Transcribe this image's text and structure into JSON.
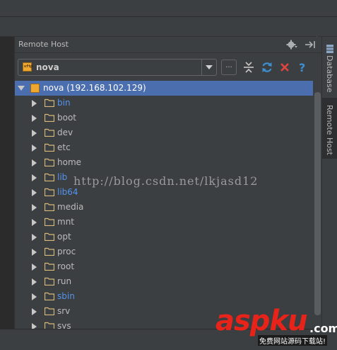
{
  "panel": {
    "title": "Remote Host",
    "host": {
      "name": "nova",
      "browse_label": "..."
    }
  },
  "tree": {
    "root": {
      "label": "nova (192.168.102.129)",
      "expanded": true,
      "selected": true
    },
    "items": [
      {
        "label": "bin",
        "link": true
      },
      {
        "label": "boot",
        "link": false
      },
      {
        "label": "dev",
        "link": false
      },
      {
        "label": "etc",
        "link": false
      },
      {
        "label": "home",
        "link": false
      },
      {
        "label": "lib",
        "link": true
      },
      {
        "label": "lib64",
        "link": true
      },
      {
        "label": "media",
        "link": false
      },
      {
        "label": "mnt",
        "link": false
      },
      {
        "label": "opt",
        "link": false
      },
      {
        "label": "proc",
        "link": false
      },
      {
        "label": "root",
        "link": false
      },
      {
        "label": "run",
        "link": false
      },
      {
        "label": "sbin",
        "link": true
      },
      {
        "label": "srv",
        "link": false
      },
      {
        "label": "sys",
        "link": false
      }
    ]
  },
  "side_tabs": [
    {
      "label": "Database",
      "active": false
    },
    {
      "label": "Remote Host",
      "active": true
    }
  ],
  "watermark": "http://blog.csdn.net/lkjasd12",
  "brand": {
    "logo": "aspku",
    "domain": ".com",
    "tagline": "免费网站源码下载站!"
  },
  "colors": {
    "selection": "#4b6eaf",
    "link": "#5394ec",
    "refresh": "#3d8fd1",
    "close": "#e0443e",
    "help": "#3d8fd1"
  }
}
